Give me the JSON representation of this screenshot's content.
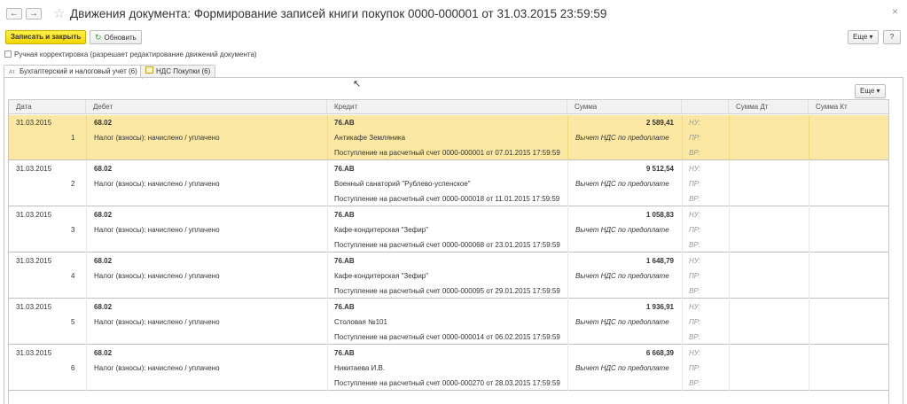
{
  "window": {
    "title": "Движения документа: Формирование записей книги покупок 0000-000001 от 31.03.2015 23:59:59",
    "back": "←",
    "forward": "→",
    "star": "☆",
    "close": "×"
  },
  "toolbar": {
    "save_close": "Записать и закрыть",
    "refresh": "Обновить",
    "more": "Еще",
    "help": "?"
  },
  "manual_edit": {
    "label": "Ручная корректировка (разрешает редактирование движений документа)",
    "checked": false
  },
  "tabs": [
    {
      "label": "Бухгалтерский и налоговый учет (6)",
      "icon": "accounting-icon",
      "active": true
    },
    {
      "label": "НДС Покупки (6)",
      "icon": "register-icon",
      "active": false
    }
  ],
  "table": {
    "more": "Еще",
    "columns": [
      "Дата",
      "Дебет",
      "Кредит",
      "Сумма",
      "",
      "Сумма Дт",
      "Сумма Кт"
    ],
    "rows": [
      {
        "date": "31.03.2015",
        "num": "1",
        "debit": "68.02",
        "debit_sub": "Налог (взносы): начислено / уплачено",
        "credit": "76.АВ",
        "credit_sub1": "Антикафе Земляника",
        "credit_sub2": "Поступление на расчетный счет 0000-000001 от 07.01.2015 17:59:59",
        "sum": "2 589,41",
        "sum_note": "Вычет НДС по предоплате",
        "nu": "НУ:",
        "pr": "ПР:",
        "vr": "ВР:",
        "selected": true
      },
      {
        "date": "31.03.2015",
        "num": "2",
        "debit": "68.02",
        "debit_sub": "Налог (взносы): начислено / уплачено",
        "credit": "76.АВ",
        "credit_sub1": "Военный санаторий \"Рублево-успенское\"",
        "credit_sub2": "Поступление на расчетный счет 0000-000018 от 11.01.2015 17:59:59",
        "sum": "9 512,54",
        "sum_note": "Вычет НДС по предоплате",
        "nu": "НУ:",
        "pr": "ПР:",
        "vr": "ВР:",
        "selected": false
      },
      {
        "date": "31.03.2015",
        "num": "3",
        "debit": "68.02",
        "debit_sub": "Налог (взносы): начислено / уплачено",
        "credit": "76.АВ",
        "credit_sub1": "Кафе-кондитерская \"Зефир\"",
        "credit_sub2": "Поступление на расчетный счет 0000-000068 от 23.01.2015 17:59:59",
        "sum": "1 058,83",
        "sum_note": "Вычет НДС по предоплате",
        "nu": "НУ:",
        "pr": "ПР:",
        "vr": "ВР:",
        "selected": false
      },
      {
        "date": "31.03.2015",
        "num": "4",
        "debit": "68.02",
        "debit_sub": "Налог (взносы): начислено / уплачено",
        "credit": "76.АВ",
        "credit_sub1": "Кафе-кондитерская \"Зефир\"",
        "credit_sub2": "Поступление на расчетный счет 0000-000095 от 29.01.2015 17:59:59",
        "sum": "1 648,79",
        "sum_note": "Вычет НДС по предоплате",
        "nu": "НУ:",
        "pr": "ПР:",
        "vr": "ВР:",
        "selected": false
      },
      {
        "date": "31.03.2015",
        "num": "5",
        "debit": "68.02",
        "debit_sub": "Налог (взносы): начислено / уплачено",
        "credit": "76.АВ",
        "credit_sub1": "Столовая №101",
        "credit_sub2": "Поступление на расчетный счет 0000-000014 от 06.02.2015 17:59:59",
        "sum": "1 936,91",
        "sum_note": "Вычет НДС по предоплате",
        "nu": "НУ:",
        "pr": "ПР:",
        "vr": "ВР:",
        "selected": false
      },
      {
        "date": "31.03.2015",
        "num": "6",
        "debit": "68.02",
        "debit_sub": "Налог (взносы): начислено / уплачено",
        "credit": "76.АВ",
        "credit_sub1": "Никитаева И.В.",
        "credit_sub2": "Поступление на расчетный счет 0000-000270 от 28.03.2015 17:59:59",
        "sum": "6 668,39",
        "sum_note": "Вычет НДС по предоплате",
        "nu": "НУ:",
        "pr": "ПР:",
        "vr": "ВР:",
        "selected": false
      }
    ]
  }
}
